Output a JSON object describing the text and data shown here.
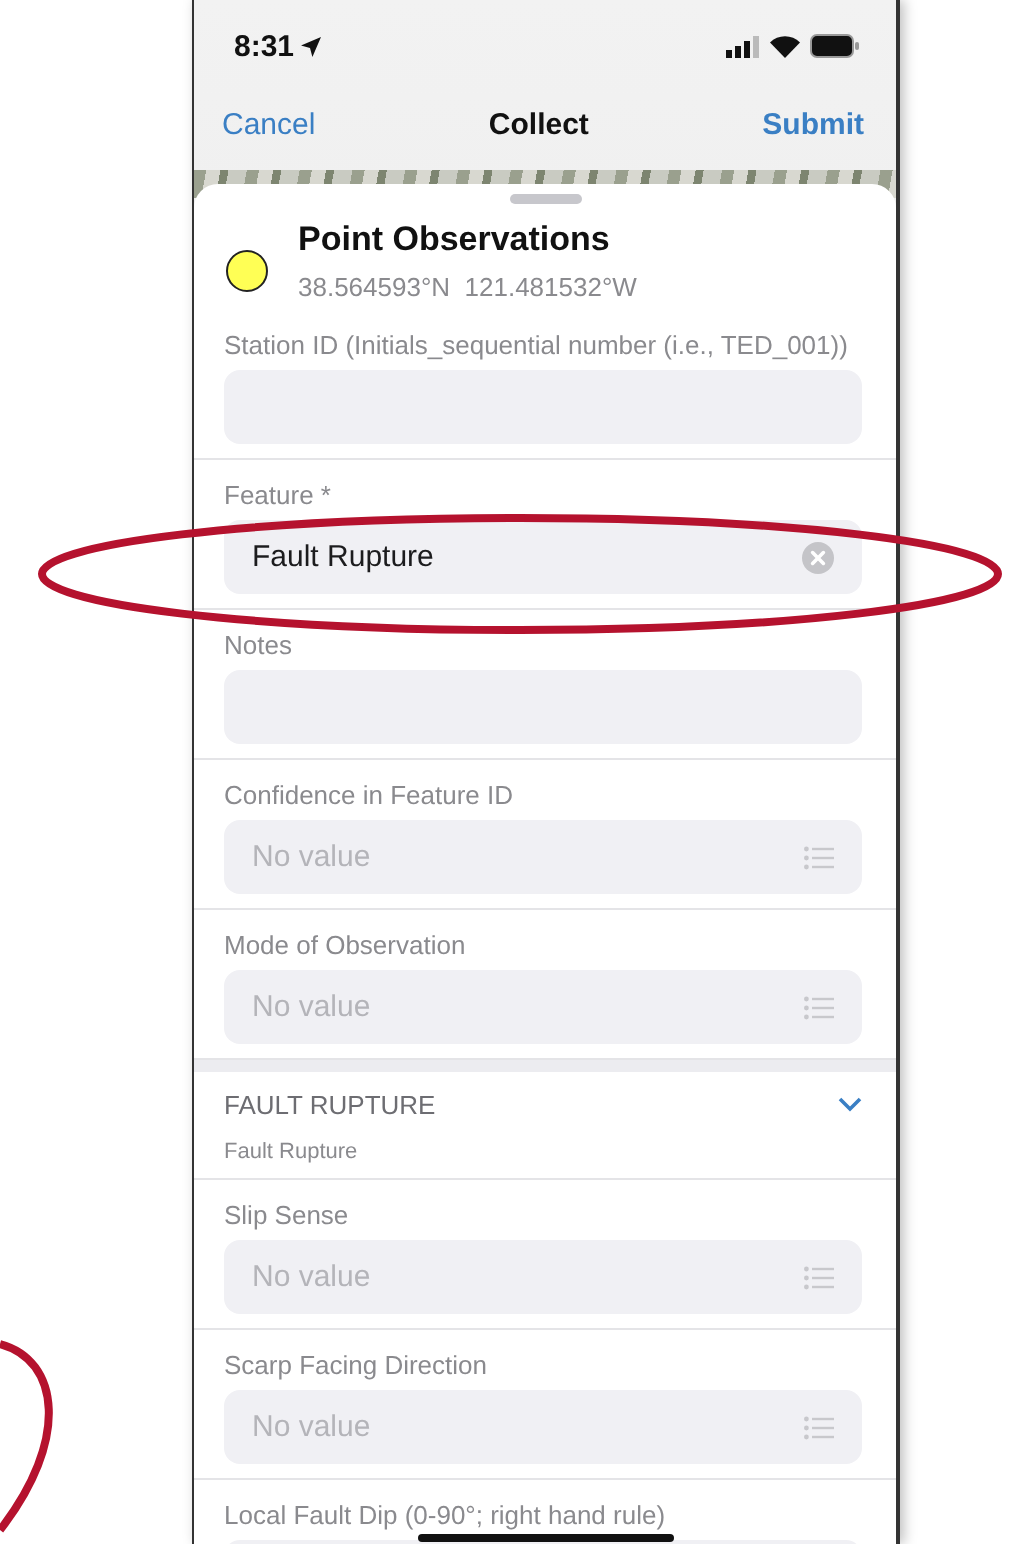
{
  "status_bar": {
    "time": "8:31"
  },
  "nav_bar": {
    "cancel": "Cancel",
    "title": "Collect",
    "submit": "Submit"
  },
  "header": {
    "title": "Point Observations",
    "coordinates": "38.564593°N  121.481532°W",
    "color": "#ffff55"
  },
  "fields": [
    {
      "kind": "text",
      "label": "Station ID (Initials_sequential number (i.e., TED_001))"
    },
    {
      "kind": "text",
      "label": "Feature *",
      "value": "Fault Rupture"
    },
    {
      "kind": "text",
      "label": "Notes"
    },
    {
      "kind": "choice",
      "label": "Confidence in Feature ID",
      "placeholder": "No value"
    },
    {
      "kind": "choice",
      "label": "Mode of Observation",
      "placeholder": "No value"
    }
  ],
  "section": {
    "title": "FAULT RUPTURE",
    "subtitle": "Fault Rupture",
    "expanded": true,
    "fields": [
      {
        "kind": "choice",
        "label": "Slip Sense",
        "placeholder": "No value"
      },
      {
        "kind": "choice",
        "label": "Scarp Facing Direction",
        "placeholder": "No value"
      },
      {
        "kind": "text",
        "label": "Local Fault Dip (0-90°; right hand rule)"
      }
    ]
  }
}
